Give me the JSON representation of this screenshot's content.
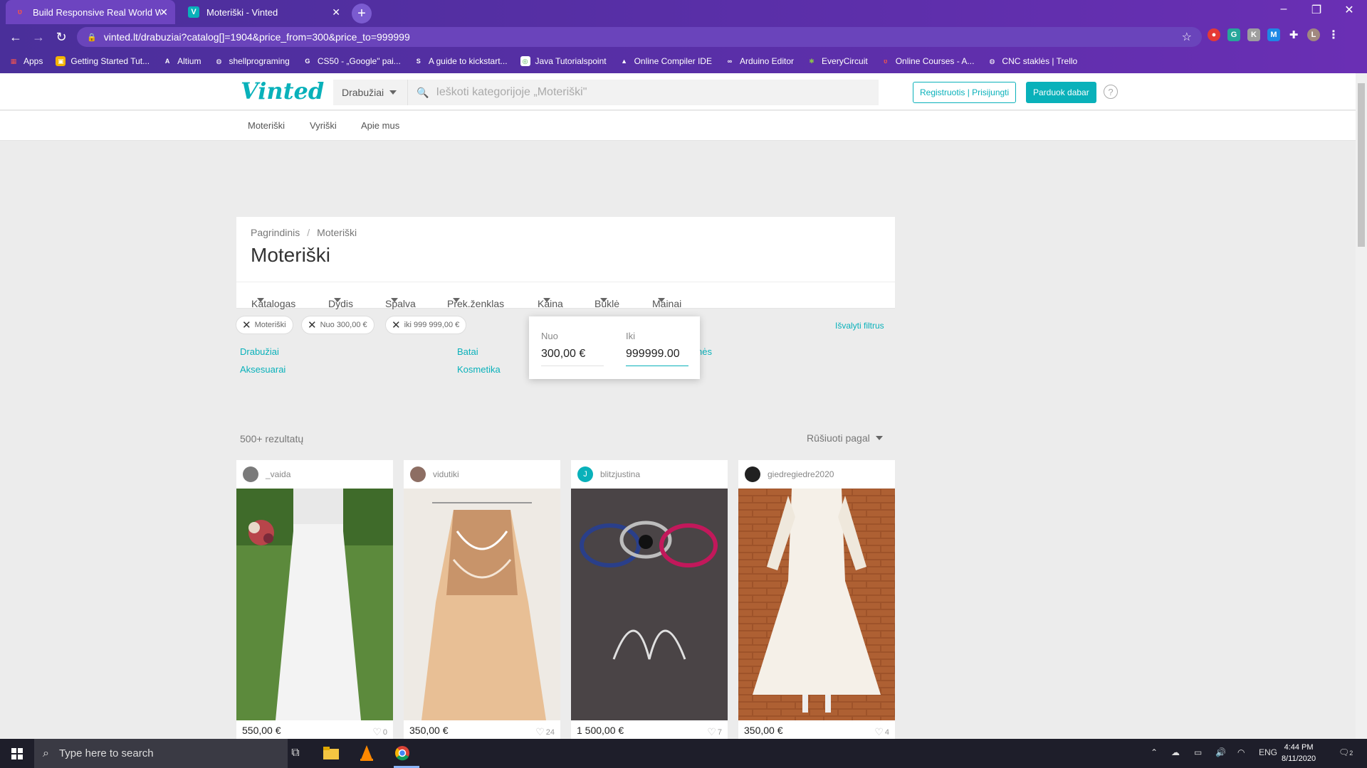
{
  "browser": {
    "tabs": [
      {
        "title": "Build Responsive Real World We",
        "active": true
      },
      {
        "title": "Moteriški - Vinted",
        "active": false
      }
    ],
    "url": "vinted.lt/drabuziai?catalog[]=1904&price_from=300&price_to=999999",
    "bookmarks": [
      {
        "label": "Apps",
        "icon": "apps-grid-icon"
      },
      {
        "label": "Getting Started Tut...",
        "icon": "windows-logo-icon"
      },
      {
        "label": "Altium",
        "icon": "altium-icon"
      },
      {
        "label": "shellprograming",
        "icon": "globe-icon"
      },
      {
        "label": "CS50 - „Google\" pai...",
        "icon": "google-icon"
      },
      {
        "label": "A guide to kickstart...",
        "icon": "doc-icon"
      },
      {
        "label": "Java  Tutorialspoint",
        "icon": "java-icon"
      },
      {
        "label": "Online Compiler IDE",
        "icon": "compiler-icon"
      },
      {
        "label": "Arduino Editor",
        "icon": "arduino-icon"
      },
      {
        "label": "EveryCircuit",
        "icon": "circuit-icon"
      },
      {
        "label": "Online Courses - A...",
        "icon": "udemy-icon"
      },
      {
        "label": "CNC staklės | Trello",
        "icon": "globe-icon"
      }
    ]
  },
  "header": {
    "logo": "Vinted",
    "category_select": "Drabužiai",
    "search_placeholder": "Ieškoti kategorijoje „Moteriški\"",
    "register_label": "Registruotis | Prisijungti",
    "sell_label": "Parduok dabar",
    "help": "?"
  },
  "subnav": [
    "Moteriški",
    "Vyriški",
    "Apie mus"
  ],
  "breadcrumb": {
    "home": "Pagrindinis",
    "separator": "/",
    "current": "Moteriški"
  },
  "page_title": "Moteriški",
  "filters": [
    "Katalogas",
    "Dydis",
    "Spalva",
    "Prek.ženklas",
    "Kaina",
    "Būklė",
    "Mainai"
  ],
  "chips": [
    "Moteriški",
    "Nuo 300,00 €",
    "iki 999 999,00 €"
  ],
  "clear_filters": "Išvalyti filtrus",
  "categories": [
    "Drabužiai",
    "Aksesuarai",
    "Batai",
    "Kosmetika",
    "nės"
  ],
  "price_popup": {
    "from_label": "Nuo",
    "from_value": "300,00 €",
    "to_label": "Iki",
    "to_value": "999999.00"
  },
  "results": {
    "count": "500+ rezultatų",
    "sort_label": "Rūšiuoti pagal"
  },
  "items": [
    {
      "user": "_vaida",
      "price": "550,00 €",
      "likes": "0"
    },
    {
      "user": "vidutiki",
      "price": "350,00 €",
      "likes": "24"
    },
    {
      "user": "blitzjustina",
      "avatar_letter": "J",
      "price": "1 500,00 €",
      "likes": "7"
    },
    {
      "user": "giedregiedre2020",
      "price": "350,00 €",
      "likes": "4"
    }
  ],
  "taskbar": {
    "search_placeholder": "Type here to search",
    "language": "ENG",
    "time": "4:44 PM",
    "date": "8/11/2020",
    "notifications": "2"
  },
  "colors": {
    "accent": "#09b1ba",
    "titlebar": "#5a2fa8"
  }
}
